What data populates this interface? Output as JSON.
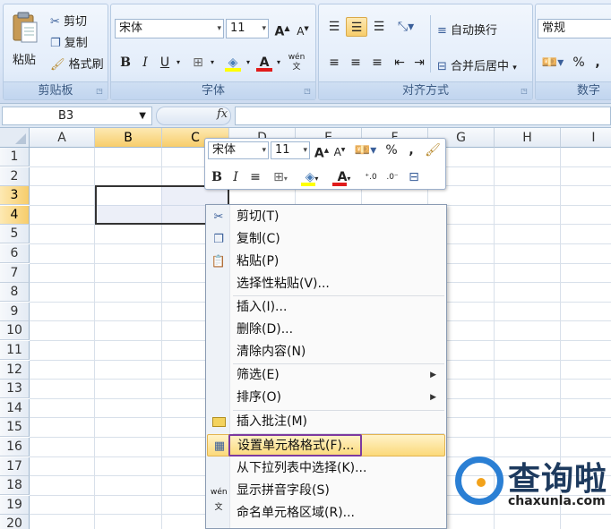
{
  "ribbon": {
    "clipboard": {
      "paste_label": "粘贴",
      "cut_label": "剪切",
      "copy_label": "复制",
      "format_painter_label": "格式刷",
      "group_label": "剪贴板"
    },
    "font": {
      "font_name": "宋体",
      "font_size": "11",
      "bold": "B",
      "italic": "I",
      "underline": "U",
      "font_color_glyph": "A",
      "phonetic_glyph": "wén",
      "group_label": "字体"
    },
    "alignment": {
      "wrap_text_label": "自动换行",
      "merge_center_label": "合并后居中",
      "group_label": "对齐方式"
    },
    "number": {
      "format_value": "常规",
      "percent": "%",
      "comma": ",",
      "group_label": "数字"
    }
  },
  "formula_bar": {
    "name_box": "B3",
    "fx_label": "fx",
    "formula": ""
  },
  "grid": {
    "columns": [
      "A",
      "B",
      "C",
      "D",
      "E",
      "F",
      "G",
      "H",
      "I"
    ],
    "selected_columns": [
      "B",
      "C"
    ],
    "rows": [
      "1",
      "2",
      "3",
      "4",
      "5",
      "6",
      "7",
      "8",
      "9",
      "10",
      "11",
      "12",
      "13",
      "14",
      "15",
      "16",
      "17",
      "18",
      "19",
      "20"
    ],
    "selected_rows": [
      "3",
      "4"
    ],
    "selection_range": "B3:C4"
  },
  "mini_toolbar": {
    "font_name": "宋体",
    "font_size": "11",
    "percent": "%",
    "comma": ",",
    "bold": "B",
    "italic": "I",
    "font_color_glyph": "A"
  },
  "context_menu": {
    "items": [
      {
        "label": "剪切(T)",
        "icon": "scissors-icon"
      },
      {
        "label": "复制(C)",
        "icon": "copy-icon"
      },
      {
        "label": "粘贴(P)",
        "icon": "paste-icon"
      },
      {
        "label": "选择性粘贴(V)...",
        "icon": ""
      },
      {
        "label": "插入(I)...",
        "icon": ""
      },
      {
        "label": "删除(D)...",
        "icon": ""
      },
      {
        "label": "清除内容(N)",
        "icon": ""
      },
      {
        "label": "筛选(E)",
        "icon": "",
        "submenu": true
      },
      {
        "label": "排序(O)",
        "icon": "",
        "submenu": true
      },
      {
        "label": "插入批注(M)",
        "icon": "comment-icon"
      },
      {
        "label": "设置单元格格式(F)...",
        "icon": "format-cells-icon",
        "highlighted": true
      },
      {
        "label": "从下拉列表中选择(K)...",
        "icon": ""
      },
      {
        "label": "显示拼音字段(S)",
        "icon": "phonetic-icon"
      },
      {
        "label": "命名单元格区域(R)...",
        "icon": ""
      }
    ]
  },
  "watermark": {
    "title": "查询啦",
    "url": "chaxunla.com"
  },
  "colors": {
    "ribbon_bg": "#dbe7f7",
    "selection_header": "#f7cd6b",
    "menu_highlight": "#fbd97a",
    "annotation_box": "#7d3aa0",
    "watermark_blue": "#2a7fd4",
    "watermark_orange": "#f2a21b"
  }
}
